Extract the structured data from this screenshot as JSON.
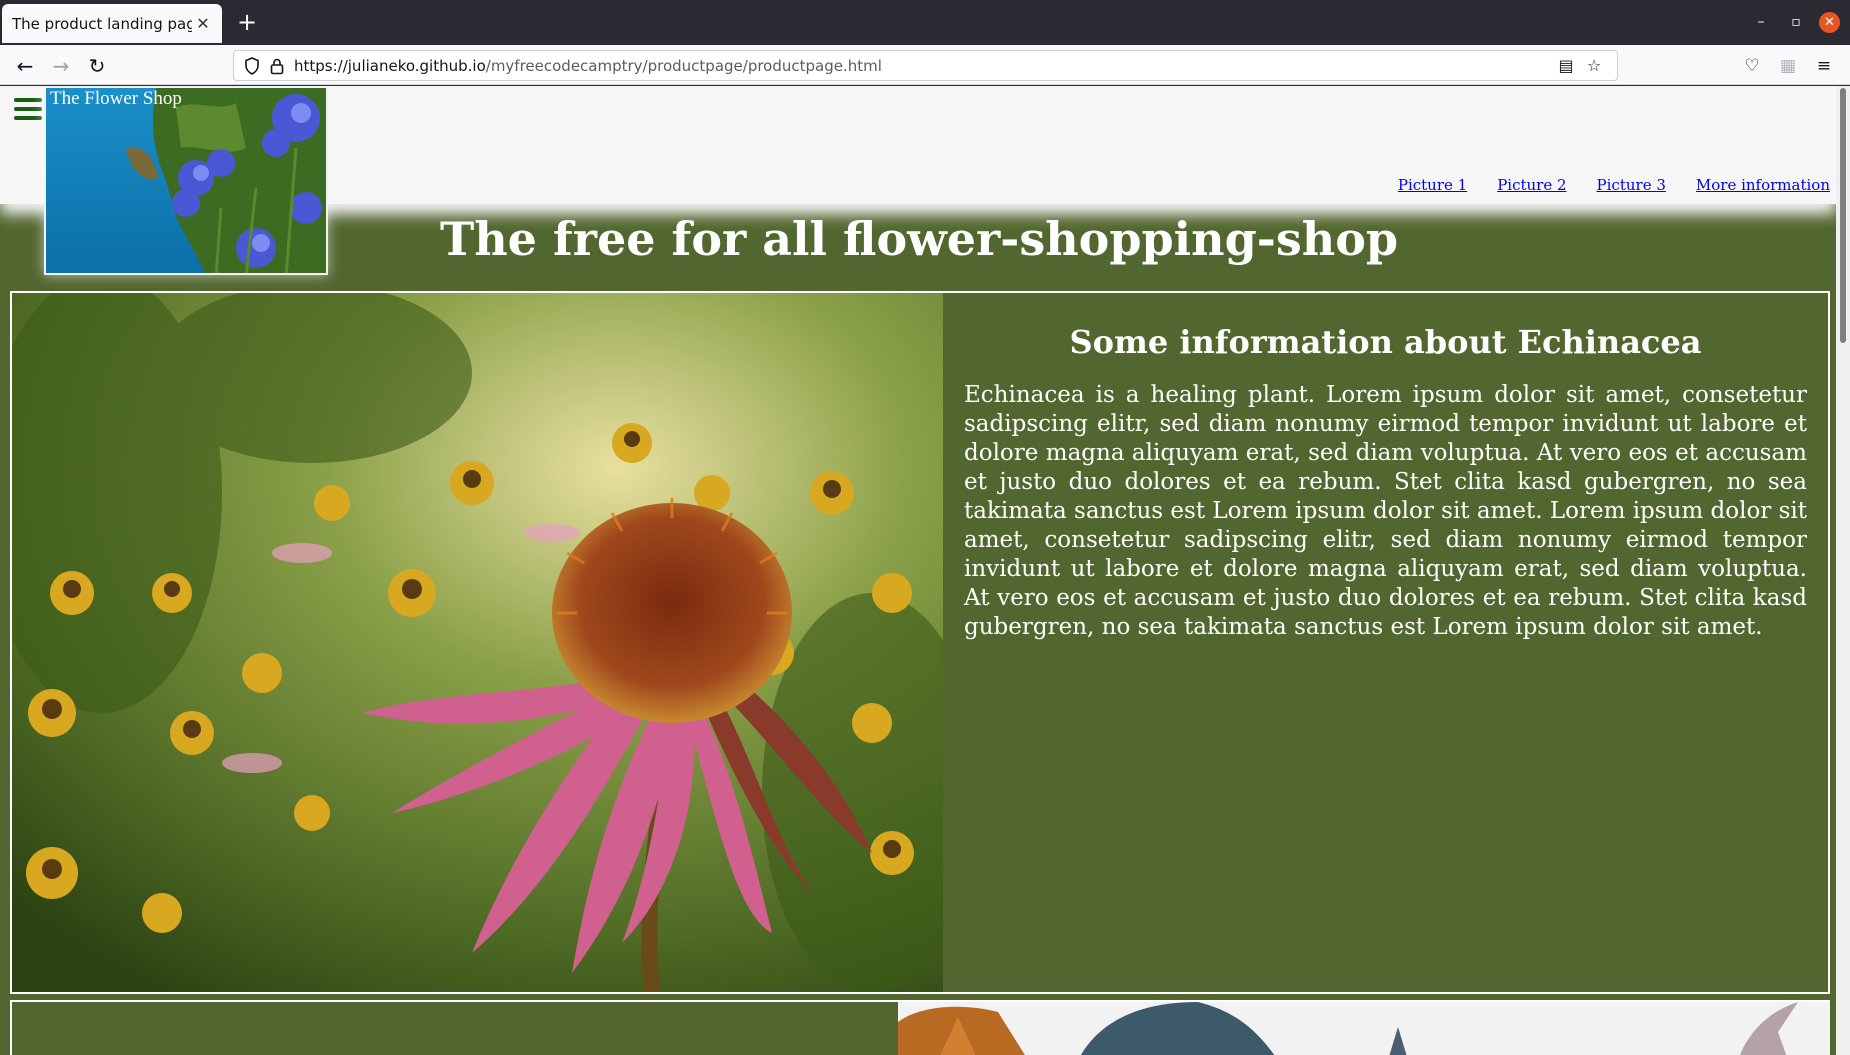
{
  "browser": {
    "tab_title": "The product landing page",
    "tab_close": "✕",
    "new_tab": "+",
    "url_domain": "https://julianeko.github.io",
    "url_path": "/myfreecodecamptry/productpage/productpage.html",
    "window_controls": {
      "minimize": "–",
      "restore": "▫",
      "close": "✕"
    }
  },
  "page": {
    "logo_caption": "The Flower Shop",
    "nav_links": [
      "Picture 1",
      "Picture 2",
      "Picture 3",
      "More information"
    ],
    "title": "The free for all flower-shopping-shop",
    "info_heading": "Some information about Echinacea",
    "info_text": "Echinacea is a healing plant. Lorem ipsum dolor sit amet, consetetur sadipscing elitr, sed diam nonumy eirmod tempor invidunt ut labore et dolore magna aliquyam erat, sed diam voluptua. At vero eos et accusam et justo duo dolores et ea rebum. Stet clita kasd gubergren, no sea takimata sanctus est Lorem ipsum dolor sit amet. Lorem ipsum dolor sit amet, consetetur sadipscing elitr, sed diam nonumy eirmod tempor invidunt ut labore et dolore magna aliquyam erat, sed diam voluptua. At vero eos et accusam et justo duo dolores et ea rebum. Stet clita kasd gubergren, no sea takimata sanctus est Lorem ipsum dolor sit amet."
  },
  "colors": {
    "page_green": "#52672f",
    "header_bg": "#f6f6f6",
    "link_blue": "#0000ee",
    "hamburger_green": "#1a5c14"
  }
}
